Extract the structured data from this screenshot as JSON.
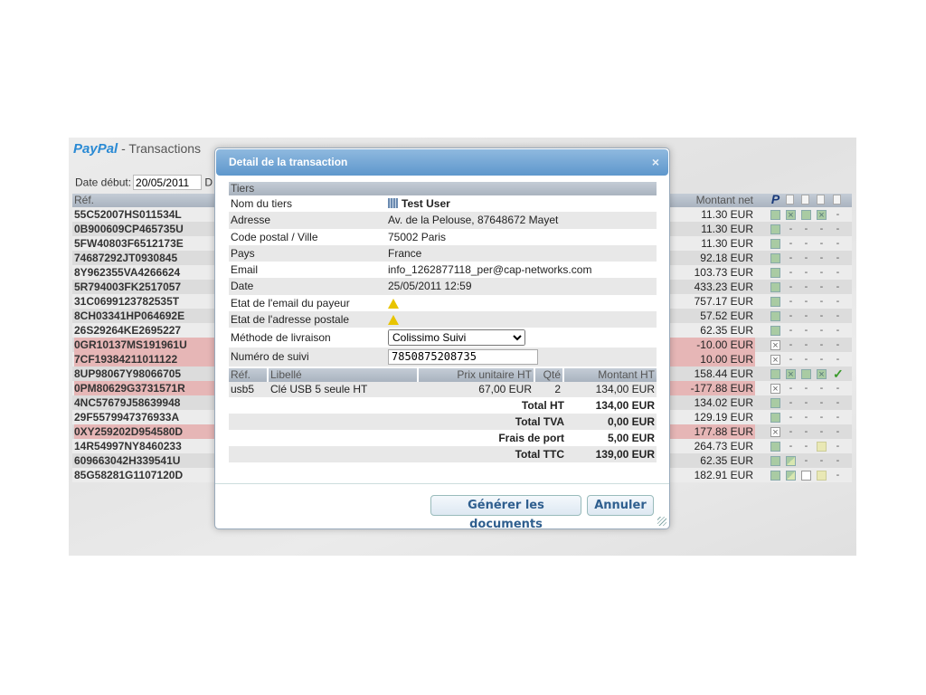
{
  "app": {
    "brand_pay": "Pay",
    "brand_pal": "Pal",
    "title": " - Transactions",
    "date_label": "Date début:",
    "date_value": "20/05/2011",
    "date_cut": "D"
  },
  "table": {
    "col_ref": "Réf.",
    "col_amount": "Montant net",
    "status_icons": [
      "paypal-icon",
      "invoice-icon",
      "shipping-icon",
      "document-icon",
      "mail-icon"
    ],
    "rows": [
      {
        "ref": "55C52007HS011534L",
        "amount": "11.30 EUR",
        "red": false,
        "status": [
          "g",
          "gx",
          "g",
          "gx",
          "-"
        ]
      },
      {
        "ref": "0B900609CP465735U",
        "amount": "11.30 EUR",
        "red": false,
        "status": [
          "g",
          "-",
          "-",
          "-",
          "-"
        ]
      },
      {
        "ref": "5FW40803F6512173E",
        "amount": "11.30 EUR",
        "red": false,
        "status": [
          "g",
          "-",
          "-",
          "-",
          "-"
        ]
      },
      {
        "ref": "74687292JT0930845",
        "amount": "92.18 EUR",
        "red": false,
        "status": [
          "g",
          "-",
          "-",
          "-",
          "-"
        ]
      },
      {
        "ref": "8Y962355VA4266624",
        "amount": "103.73 EUR",
        "red": false,
        "status": [
          "g",
          "-",
          "-",
          "-",
          "-"
        ]
      },
      {
        "ref": "5R794003FK2517057",
        "amount": "433.23 EUR",
        "red": false,
        "status": [
          "g",
          "-",
          "-",
          "-",
          "-"
        ]
      },
      {
        "ref": "31C0699123782535T",
        "amount": "757.17 EUR",
        "red": false,
        "status": [
          "g",
          "-",
          "-",
          "-",
          "-"
        ]
      },
      {
        "ref": "8CH03341HP064692E",
        "amount": "57.52 EUR",
        "red": false,
        "status": [
          "g",
          "-",
          "-",
          "-",
          "-"
        ]
      },
      {
        "ref": "26S29264KE2695227",
        "amount": "62.35 EUR",
        "red": false,
        "status": [
          "g",
          "-",
          "-",
          "-",
          "-"
        ]
      },
      {
        "ref": "0GR10137MS191961U",
        "amount": "-10.00 EUR",
        "red": true,
        "status": [
          "x",
          "-",
          "-",
          "-",
          "-"
        ]
      },
      {
        "ref": "7CF19384211011122",
        "amount": "10.00 EUR",
        "red": true,
        "status": [
          "x",
          "-",
          "-",
          "-",
          "-"
        ]
      },
      {
        "ref": "8UP98067Y98066705",
        "amount": "158.44 EUR",
        "red": false,
        "status": [
          "g",
          "gx",
          "g",
          "gx",
          "check"
        ]
      },
      {
        "ref": "0PM80629G3731571R",
        "amount": "-177.88 EUR",
        "red": true,
        "status": [
          "x",
          "-",
          "-",
          "-",
          "-"
        ]
      },
      {
        "ref": "4NC57679J58639948",
        "amount": "134.02 EUR",
        "red": false,
        "status": [
          "g",
          "-",
          "-",
          "-",
          "-"
        ]
      },
      {
        "ref": "29F5579947376933A",
        "amount": "129.19 EUR",
        "red": false,
        "status": [
          "g",
          "-",
          "-",
          "-",
          "-"
        ]
      },
      {
        "ref": "0XY259202D954580D",
        "amount": "177.88 EUR",
        "red": true,
        "status": [
          "x",
          "-",
          "-",
          "-",
          "-"
        ]
      },
      {
        "ref": "14R54997NY8460233",
        "amount": "264.73 EUR",
        "red": false,
        "status": [
          "g",
          "-",
          "-",
          "y",
          "-"
        ]
      },
      {
        "ref": "609663042H339541U",
        "amount": "62.35 EUR",
        "red": false,
        "status": [
          "g",
          "h",
          "-",
          "-",
          "-"
        ]
      },
      {
        "ref": "85G58281G1107120D",
        "amount": "182.91 EUR",
        "red": false,
        "status": [
          "g",
          "h",
          "w",
          "y",
          "-"
        ]
      }
    ]
  },
  "modal": {
    "title": "Detail de la transaction",
    "close": "×",
    "section": "Tiers",
    "fields": {
      "name_label": "Nom du tiers",
      "name_value": "Test User",
      "address_label": "Adresse",
      "address_value": "Av. de la Pelouse, 87648672 Mayet",
      "city_label": "Code postal / Ville",
      "city_value": "75002 Paris",
      "country_label": "Pays",
      "country_value": "France",
      "email_label": "Email",
      "email_value": "info_1262877118_per@cap-networks.com",
      "date_label": "Date",
      "date_value": "25/05/2011 12:59",
      "email_state_label": "Etat de l'email du payeur",
      "address_state_label": "Etat de l'adresse postale",
      "shipping_label": "Méthode de livraison",
      "shipping_value": "Colissimo Suivi",
      "tracking_label": "Numéro de suivi",
      "tracking_value": "7850875208735"
    },
    "items_header": {
      "ref": "Réf.",
      "label": "Libellé",
      "unit": "Prix unitaire HT",
      "qty": "Qté",
      "amount": "Montant HT"
    },
    "items": [
      {
        "ref": "usb5",
        "label": "Clé USB 5 seule HT",
        "unit": "67,00 EUR",
        "qty": "2",
        "amount": "134,00 EUR"
      }
    ],
    "totals": [
      {
        "label": "Total HT",
        "value": "134,00 EUR"
      },
      {
        "label": "Total TVA",
        "value": "0,00 EUR"
      },
      {
        "label": "Frais de port",
        "value": "5,00 EUR"
      },
      {
        "label": "Total TTC",
        "value": "139,00 EUR"
      }
    ],
    "generate": "Générer les documents",
    "cancel": "Annuler"
  }
}
